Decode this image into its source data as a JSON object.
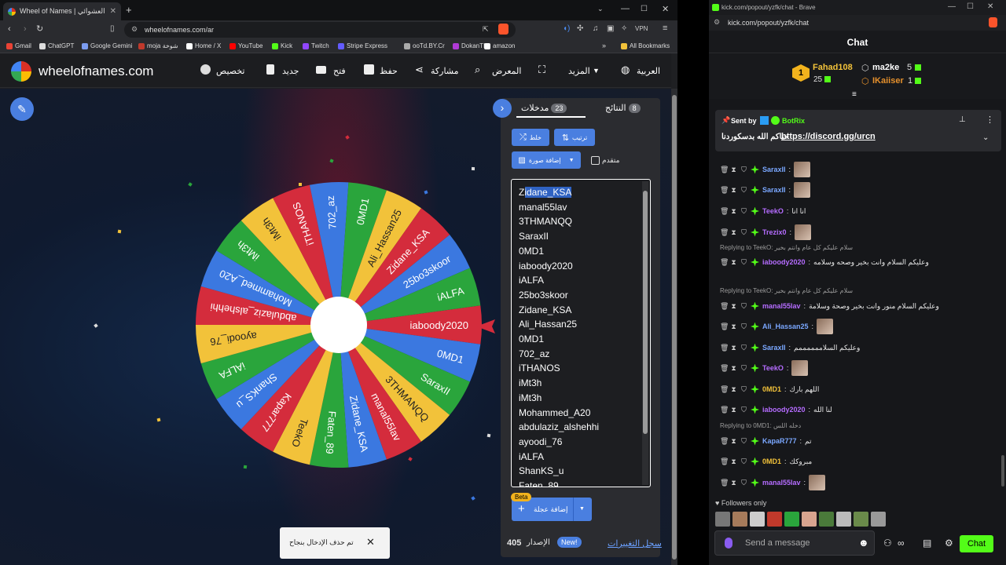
{
  "browser": {
    "tab_title": "Wheel of Names | العشوائي",
    "url": "wheelofnames.com/ar",
    "vpn_label": "VPN",
    "bookmarks": [
      {
        "label": "Gmail",
        "color": "#ea4335"
      },
      {
        "label": "ChatGPT",
        "color": "#dddddd"
      },
      {
        "label": "Google Gemini",
        "color": "#7b9cf0"
      },
      {
        "label": "moja شوخة",
        "color": "#c0392b"
      },
      {
        "label": "Home / X",
        "color": "#ffffff"
      },
      {
        "label": "YouTube",
        "color": "#ff0000"
      },
      {
        "label": "Kick",
        "color": "#53fc18"
      },
      {
        "label": "Twitch",
        "color": "#9146ff"
      },
      {
        "label": "Stripe Express",
        "color": "#635bff"
      },
      {
        "label": "ooTd.BY.Cr",
        "color": "#aaaaaa"
      },
      {
        "label": "DokanTIP",
        "color": "#b03ad6"
      },
      {
        "label": "amazon",
        "color": "#ffffff"
      }
    ],
    "all_bookmarks": "All Bookmarks"
  },
  "won": {
    "brand": "wheelofnames.com",
    "menu": {
      "customize": "تخصيص",
      "new": "جديد",
      "open": "فتح",
      "save": "حفظ",
      "share": "مشاركة",
      "gallery": "المعرض",
      "more": "المزيد",
      "language": "العربية"
    },
    "wheel_entries": [
      "iaboody2020",
      "0MD1",
      "SaraxII",
      "3THMANQQ",
      "manal55lav",
      "Zidane_KSA",
      "Faten_89",
      "TeekO",
      "Kapar777",
      "ShanKS_u",
      "iALFA",
      "ayoodi_76",
      "abdulaziz_alshehhi",
      "Mohammed_A20",
      "iMt3h",
      "iMt3h",
      "iTHANOS",
      "702_az",
      "0MD1",
      "Ali_Hassan25",
      "Zidane_KSA",
      "25bo3skoor",
      "iALFA"
    ],
    "wheel_colors": [
      "#d42c3c",
      "#3b78e0",
      "#2aa53c",
      "#f2c23a"
    ],
    "panel": {
      "tab_entries": "مدخلات",
      "entries_count": "23",
      "tab_results": "النتائج",
      "results_count": "8",
      "shuffle": "خلط",
      "sort": "ترتيب",
      "add_image": "إضافة صورة",
      "advanced": "متقدم",
      "add_wheel": "إضافة عجلة",
      "beta": "Beta",
      "version_label": "الإصدار",
      "version": "405",
      "new_badge": "New!",
      "changelog": "سجل التغييرات"
    },
    "entries": [
      "Zidane_KSA",
      "manal55lav",
      "3THMANQQ",
      "SaraxII",
      "0MD1",
      "iaboody2020",
      "iALFA",
      "25bo3skoor",
      "Zidane_KSA",
      "Ali_Hassan25",
      "0MD1",
      "702_az",
      "iTHANOS",
      "iMt3h",
      "iMt3h",
      "Mohammed_A20",
      "abdulaziz_alshehhi",
      "ayoodi_76",
      "iALFA",
      "ShanKS_u",
      "Faten_89"
    ],
    "toast": "تم حذف الإدخال بنجاح"
  },
  "kick": {
    "window_title": "kick.com/popout/yzfk/chat - Brave",
    "url": "kick.com/popout/yzfk/chat",
    "chat_title": "Chat",
    "leaderboard": [
      {
        "rank": "1",
        "name": "Fahad108",
        "count": "25"
      },
      {
        "name": "ma2ke",
        "count": "5"
      },
      {
        "name": "IKaiiser",
        "count": "1"
      }
    ],
    "pinned_by_label": "Sent by",
    "pinned_by_name": "BotRix",
    "pinned_text": "حياكم الله بدسكوردنا",
    "pinned_link": "https://discord.gg/urcn",
    "messages": [
      {
        "user": "SaraxII",
        "color": "#7aa7ff",
        "text": ""
      },
      {
        "user": "SaraxII",
        "color": "#7aa7ff",
        "text": ""
      },
      {
        "user": "TeekO",
        "color": "#b56cff",
        "text": "انا انا"
      },
      {
        "user": "Trezix0",
        "color": "#b56cff",
        "text": ""
      },
      {
        "reply": "Replying to TeekO: سلام عليكم كل عام وانتم بخير"
      },
      {
        "user": "iaboody2020",
        "color": "#b56cff",
        "text": "وعليكم السلام وانت بخير وصحه وسلامه"
      },
      {
        "reply": "Replying to TeekO: سلام عليكم كل عام وانتم بخير"
      },
      {
        "user": "manal55lav",
        "color": "#b56cff",
        "text": "وعليكم السلام منور وانت بخير وصحة وسلامة"
      },
      {
        "user": "Ali_Hassan25",
        "color": "#7aa7ff",
        "text": ""
      },
      {
        "user": "SaraxII",
        "color": "#7aa7ff",
        "text": "وعليكم السلاممممممم"
      },
      {
        "user": "TeekO",
        "color": "#b56cff",
        "text": ""
      },
      {
        "user": "0MD1",
        "color": "#f2c23a",
        "text": "اللهم بارك"
      },
      {
        "user": "iaboody2020",
        "color": "#b56cff",
        "text": "لنا الله"
      },
      {
        "reply": "Replying to 0MD1: دخله اللس"
      },
      {
        "user": "KapaR777",
        "color": "#7aa7ff",
        "text": "تم"
      },
      {
        "user": "0MD1",
        "color": "#f2c23a",
        "text": "مبروكك"
      },
      {
        "user": "manal55lav",
        "color": "#b56cff",
        "text": ""
      }
    ],
    "followers_only": "Followers only",
    "send_placeholder": "Send a message",
    "chat_button": "Chat"
  }
}
